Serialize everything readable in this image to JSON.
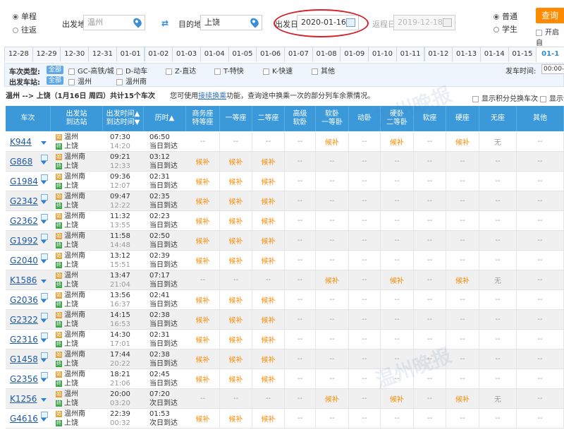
{
  "search": {
    "trip_type": [
      {
        "label": "单程",
        "checked": true
      },
      {
        "label": "往返",
        "checked": false
      }
    ],
    "from_label": "出发地",
    "from_value": "温州",
    "to_label": "目的地",
    "to_value": "上饶",
    "depart_label": "出发日",
    "depart_value": "2020-01-16",
    "return_label": "返程日",
    "return_value": "2019-12-18",
    "passenger": [
      {
        "label": "普通",
        "checked": true
      },
      {
        "label": "学生",
        "checked": false
      }
    ],
    "query_label": "查询",
    "auto_query_label": "开启自"
  },
  "dates": [
    "12-28",
    "12-29",
    "12-30",
    "12-31",
    "01-01",
    "01-02",
    "01-03",
    "01-04",
    "01-05",
    "01-06",
    "01-07",
    "01-08",
    "01-09",
    "01-10",
    "01-11",
    "01-12",
    "01-13",
    "01-14",
    "01-15",
    "01-1"
  ],
  "filter": {
    "type_label": "车次类型:",
    "all_label": "全部",
    "types": [
      "GC-高铁/城",
      "D-动车",
      "Z-直达",
      "T-特快",
      "K-快速",
      "其他"
    ],
    "station_label": "出发车站:",
    "stations": [
      "温州",
      "温州南"
    ],
    "time_label": "发车时间:",
    "time_value": "00:00-"
  },
  "summary": {
    "route": "温州 --> 上饶（1月16日 周四）共计15个车次",
    "tip_pre": "您可使用",
    "tip_link": "接续换乘",
    "tip_post": "功能，查询途中换乘一次的部分列车余票情况。",
    "points_label": "显示积分兑换车次",
    "show_label": "显示全"
  },
  "headers": [
    {
      "l1": "车次",
      "l2": ""
    },
    {
      "l1": "出发站",
      "l2": "到达站"
    },
    {
      "l1": "出发时间▲",
      "l2": "到达时间▼"
    },
    {
      "l1": "历时▲",
      "l2": ""
    },
    {
      "l1": "商务座",
      "l2": "特等座"
    },
    {
      "l1": "一等座",
      "l2": ""
    },
    {
      "l1": "二等座",
      "l2": ""
    },
    {
      "l1": "高级",
      "l2": "软卧"
    },
    {
      "l1": "软卧",
      "l2": "一等卧"
    },
    {
      "l1": "动卧",
      "l2": ""
    },
    {
      "l1": "硬卧",
      "l2": "二等卧"
    },
    {
      "l1": "软座",
      "l2": ""
    },
    {
      "l1": "硬座",
      "l2": ""
    },
    {
      "l1": "无座",
      "l2": ""
    },
    {
      "l1": "其他",
      "l2": ""
    }
  ],
  "trains": [
    {
      "no": "K944",
      "from": "温州",
      "to": "上饶",
      "dep": "07:30",
      "arr": "14:20",
      "dur": "06:50",
      "day": "当日到达",
      "seats": [
        "--",
        "--",
        "--",
        "--",
        "候补",
        "--",
        "候补",
        "--",
        "候补",
        "无",
        "--"
      ]
    },
    {
      "no": "G868",
      "from": "温州南",
      "to": "上饶",
      "dep": "09:21",
      "arr": "12:33",
      "dur": "03:12",
      "day": "当日到达",
      "seats": [
        "候补",
        "候补",
        "候补",
        "--",
        "--",
        "--",
        "--",
        "--",
        "--",
        "--",
        "--"
      ]
    },
    {
      "no": "G1984",
      "from": "温州南",
      "to": "上饶",
      "dep": "09:36",
      "arr": "12:07",
      "dur": "02:31",
      "day": "当日到达",
      "seats": [
        "候补",
        "候补",
        "候补",
        "--",
        "--",
        "--",
        "--",
        "--",
        "--",
        "--",
        "--"
      ]
    },
    {
      "no": "G2342",
      "from": "温州南",
      "to": "上饶",
      "dep": "09:47",
      "arr": "12:22",
      "dur": "02:35",
      "day": "当日到达",
      "seats": [
        "候补",
        "候补",
        "候补",
        "--",
        "--",
        "--",
        "--",
        "--",
        "--",
        "--",
        "--"
      ]
    },
    {
      "no": "G2362",
      "from": "温州南",
      "to": "上饶",
      "dep": "11:32",
      "arr": "13:55",
      "dur": "02:23",
      "day": "当日到达",
      "seats": [
        "候补",
        "候补",
        "候补",
        "--",
        "--",
        "--",
        "--",
        "--",
        "--",
        "--",
        "--"
      ]
    },
    {
      "no": "G1992",
      "from": "温州南",
      "to": "上饶",
      "dep": "11:58",
      "arr": "14:48",
      "dur": "02:50",
      "day": "当日到达",
      "seats": [
        "候补",
        "候补",
        "候补",
        "--",
        "--",
        "--",
        "--",
        "--",
        "--",
        "--",
        "--"
      ]
    },
    {
      "no": "G2040",
      "from": "温州南",
      "to": "上饶",
      "dep": "13:12",
      "arr": "15:51",
      "dur": "02:39",
      "day": "当日到达",
      "seats": [
        "候补",
        "候补",
        "候补",
        "--",
        "--",
        "--",
        "--",
        "--",
        "--",
        "--",
        "--"
      ]
    },
    {
      "no": "K1586",
      "from": "温州",
      "to": "上饶",
      "dep": "13:47",
      "arr": "21:04",
      "dur": "07:17",
      "day": "当日到达",
      "seats": [
        "--",
        "--",
        "--",
        "--",
        "候补",
        "--",
        "候补",
        "--",
        "候补",
        "无",
        "--"
      ]
    },
    {
      "no": "G2036",
      "from": "温州南",
      "to": "上饶",
      "dep": "13:56",
      "arr": "16:37",
      "dur": "02:41",
      "day": "当日到达",
      "seats": [
        "候补",
        "候补",
        "候补",
        "--",
        "--",
        "--",
        "--",
        "--",
        "--",
        "--",
        "--"
      ]
    },
    {
      "no": "G2322",
      "from": "温州南",
      "to": "上饶",
      "dep": "14:15",
      "arr": "16:53",
      "dur": "02:38",
      "day": "当日到达",
      "seats": [
        "候补",
        "候补",
        "候补",
        "--",
        "--",
        "--",
        "--",
        "--",
        "--",
        "--",
        "--"
      ]
    },
    {
      "no": "G2316",
      "from": "温州南",
      "to": "上饶",
      "dep": "14:30",
      "arr": "17:01",
      "dur": "02:31",
      "day": "当日到达",
      "seats": [
        "候补",
        "候补",
        "候补",
        "--",
        "--",
        "--",
        "--",
        "--",
        "--",
        "--",
        "--"
      ]
    },
    {
      "no": "G1458",
      "from": "温州南",
      "to": "上饶",
      "dep": "17:44",
      "arr": "20:22",
      "dur": "02:38",
      "day": "当日到达",
      "seats": [
        "候补",
        "候补",
        "候补",
        "--",
        "--",
        "--",
        "--",
        "--",
        "--",
        "--",
        "--"
      ]
    },
    {
      "no": "G2356",
      "from": "温州南",
      "to": "上饶",
      "dep": "18:21",
      "arr": "21:06",
      "dur": "02:45",
      "day": "当日到达",
      "seats": [
        "候补",
        "候补",
        "候补",
        "--",
        "--",
        "--",
        "--",
        "--",
        "--",
        "--",
        "--"
      ]
    },
    {
      "no": "K1256",
      "from": "温州",
      "to": "上饶",
      "dep": "20:00",
      "arr": "03:20",
      "dur": "07:20",
      "day": "次日到达",
      "seats": [
        "--",
        "--",
        "--",
        "--",
        "候补",
        "--",
        "候补",
        "--",
        "候补",
        "无",
        "--"
      ]
    },
    {
      "no": "G4616",
      "from": "温州南",
      "to": "上饶",
      "dep": "22:39",
      "arr": "00:32",
      "dur": "01:53",
      "day": "次日到达",
      "seats": [
        "候补",
        "候补",
        "候补",
        "--",
        "--",
        "--",
        "--",
        "--",
        "--",
        "--",
        "--"
      ]
    }
  ],
  "colors": {
    "header_bg": "#3b99d9",
    "link": "#1d5aa8",
    "waitlist": "#ff8a00",
    "query_btn": "#ff8a00",
    "annotation": "#d4202a"
  },
  "watermark": "温州晚报"
}
